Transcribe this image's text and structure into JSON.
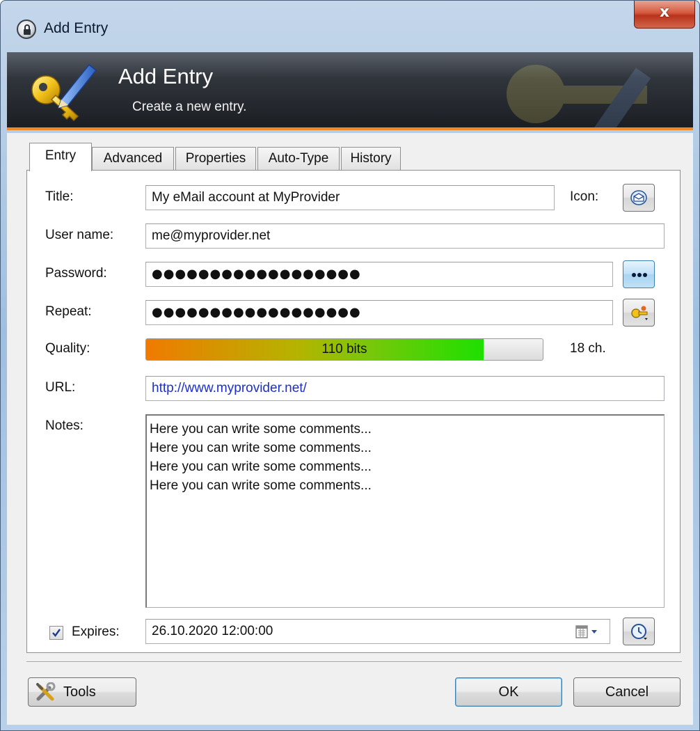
{
  "window": {
    "title": "Add Entry",
    "close_glyph": "x",
    "title_icon": "lock-icon"
  },
  "banner": {
    "title": "Add Entry",
    "subtitle": "Create a new entry.",
    "icon": "key-pencil-icon",
    "accent_color": "#f08a24"
  },
  "tabs": [
    {
      "label": "Entry",
      "active": true
    },
    {
      "label": "Advanced",
      "active": false
    },
    {
      "label": "Properties",
      "active": false
    },
    {
      "label": "Auto-Type",
      "active": false
    },
    {
      "label": "History",
      "active": false
    }
  ],
  "form": {
    "title_label": "Title:",
    "title_value": "My eMail account at MyProvider",
    "icon_label": "Icon:",
    "icon_button_icon": "envelope-icon",
    "username_label": "User name:",
    "username_value": "me@myprovider.net",
    "password_label": "Password:",
    "password_value": "●●●●●●●●●●●●●●●●●●",
    "password_toggle_icon": "dots-icon",
    "repeat_label": "Repeat:",
    "repeat_value": "●●●●●●●●●●●●●●●●●●",
    "generator_icon": "password-generator-icon",
    "quality_label": "Quality:",
    "quality_text": "110 bits",
    "quality_fraction": 0.85,
    "length_text": "18 ch.",
    "url_label": "URL:",
    "url_value": "http://www.myprovider.net/",
    "url_color": "#1c2fcd",
    "notes_label": "Notes:",
    "notes_value": "Here you can write some comments...\nHere you can write some comments...\nHere you can write some comments...\nHere you can write some comments...",
    "expires_checked": true,
    "expires_label": "Expires:",
    "expires_value": "26.10.2020 12:00:00",
    "calendar_icon": "calendar-dropdown-icon",
    "expiry_presets_icon": "clock-icon"
  },
  "buttons": {
    "tools_label": "Tools",
    "tools_icon": "tools-icon",
    "ok_label": "OK",
    "cancel_label": "Cancel"
  }
}
